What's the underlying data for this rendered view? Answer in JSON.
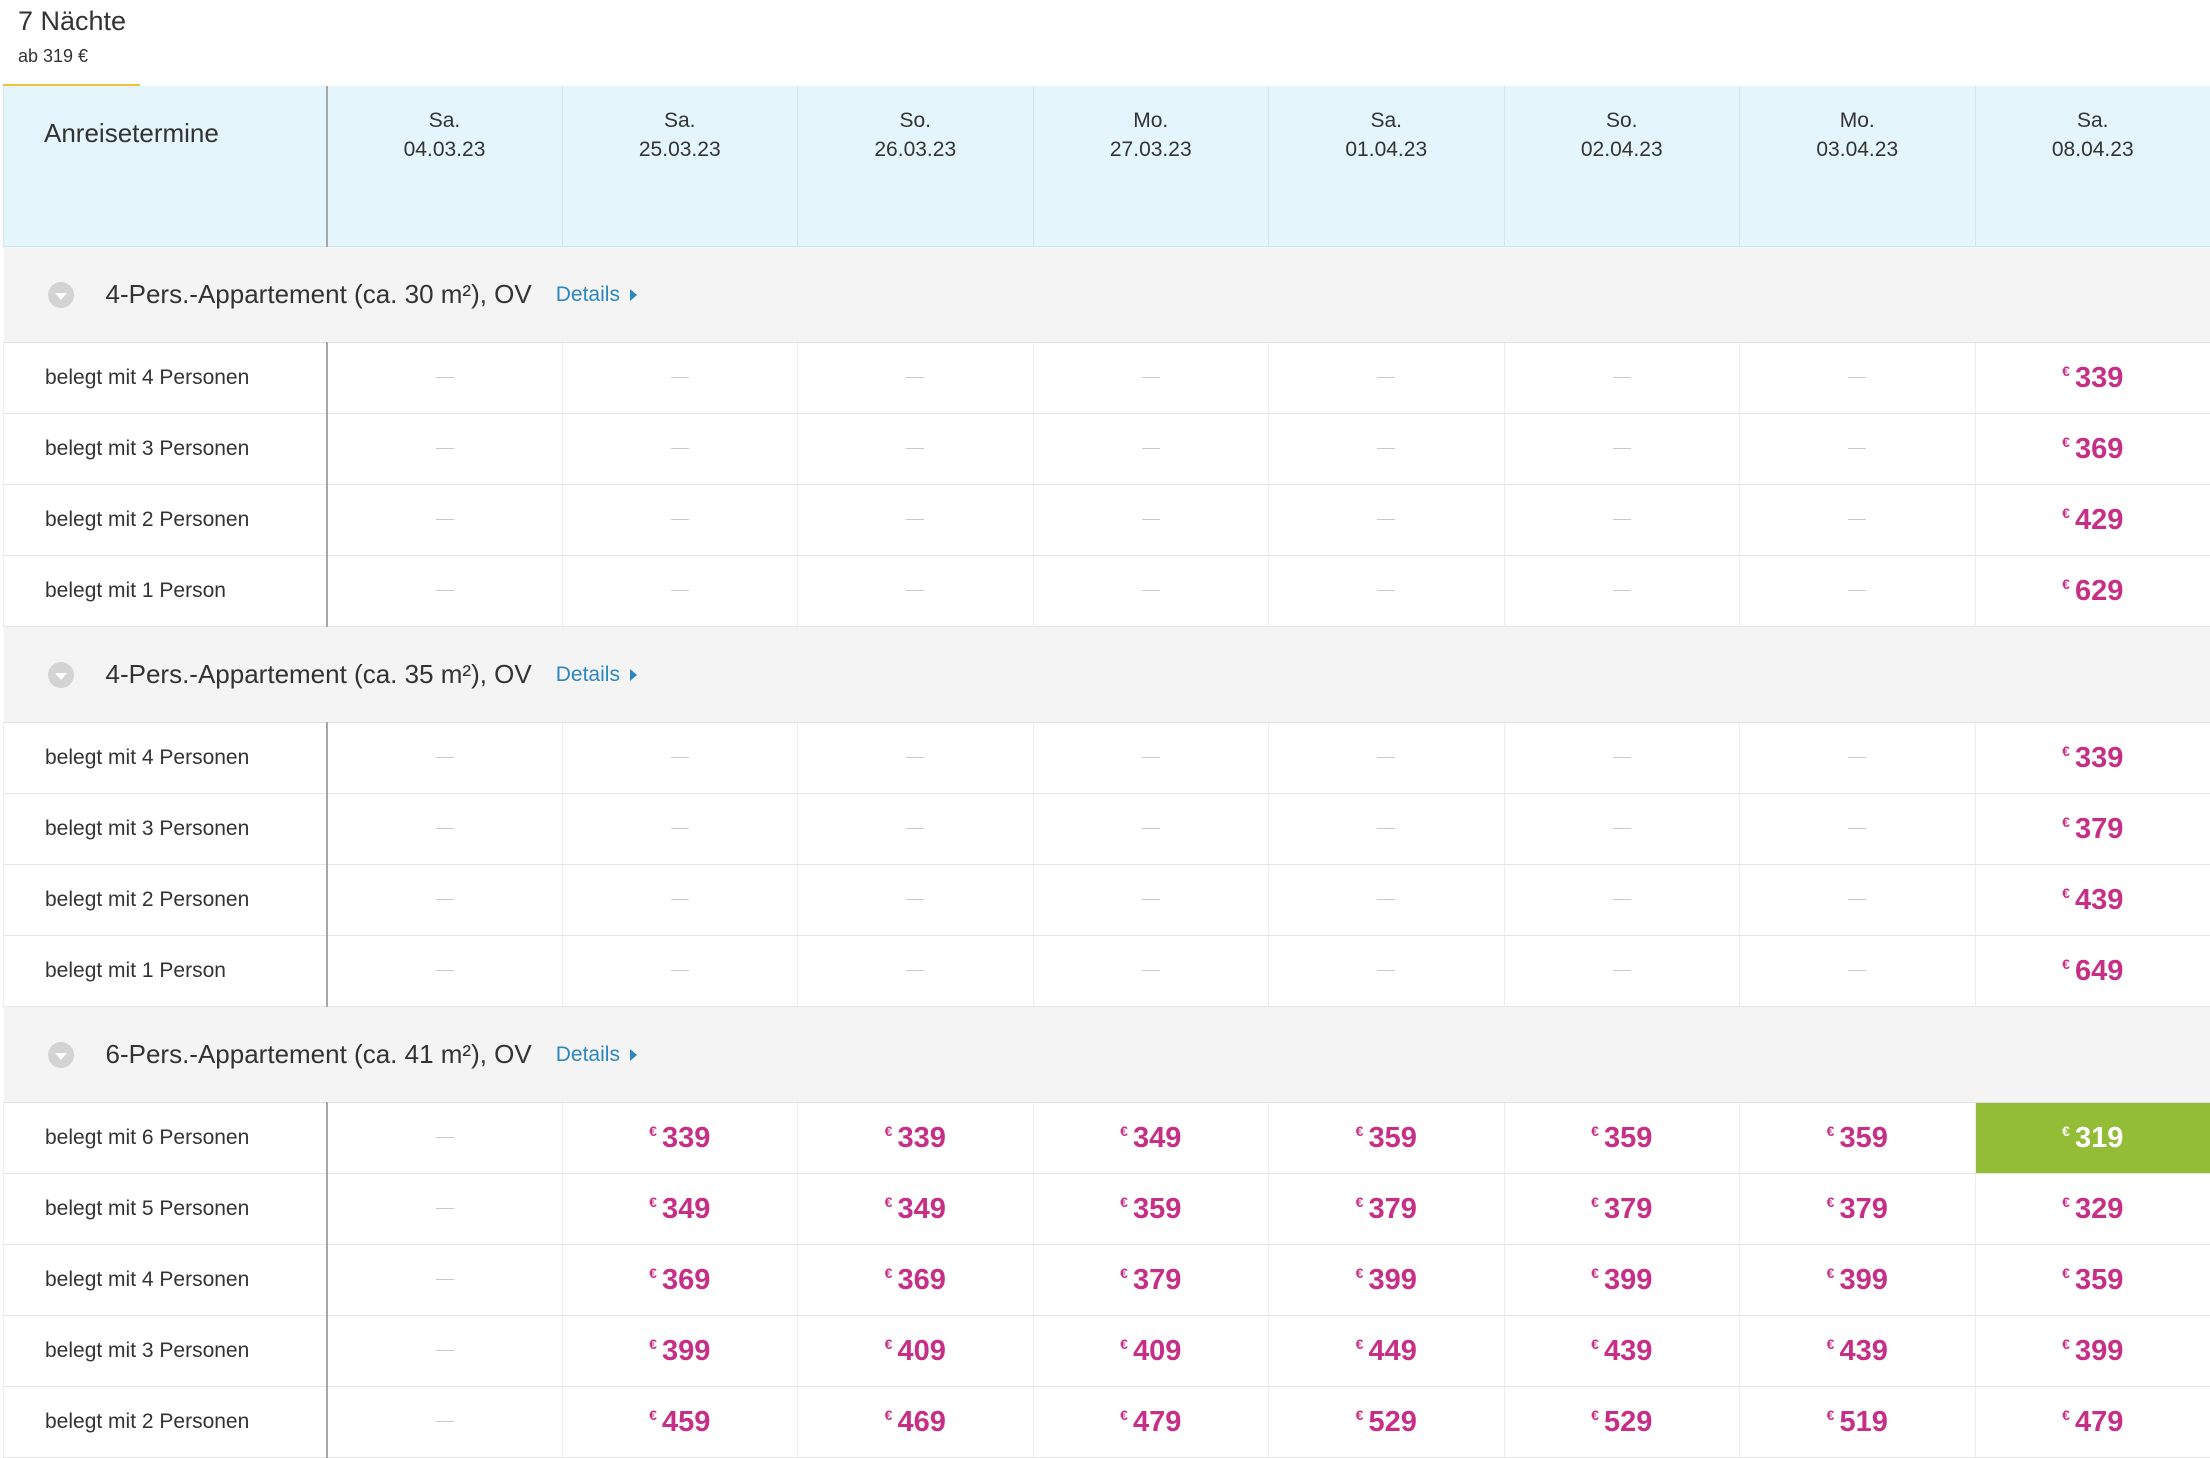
{
  "tab": {
    "title": "7 Nächte",
    "subtitle": "ab 319 €"
  },
  "header": {
    "label": "Anreisetermine",
    "dates": [
      {
        "day": "Sa.",
        "date": "04.03.23"
      },
      {
        "day": "Sa.",
        "date": "25.03.23"
      },
      {
        "day": "So.",
        "date": "26.03.23"
      },
      {
        "day": "Mo.",
        "date": "27.03.23"
      },
      {
        "day": "Sa.",
        "date": "01.04.23"
      },
      {
        "day": "So.",
        "date": "02.04.23"
      },
      {
        "day": "Mo.",
        "date": "03.04.23"
      },
      {
        "day": "Sa.",
        "date": "08.04.23"
      }
    ]
  },
  "currency_symbol": "€",
  "details_label": "Details",
  "colors": {
    "price": "#c72f86",
    "best_bg": "#93bd37",
    "header_bg": "#e5f5fc",
    "link": "#2b87be",
    "tab_underline": "#f0c33c"
  },
  "groups": [
    {
      "title": "4-Pers.-Appartement (ca. 30 m²), OV",
      "rows": [
        {
          "label": "belegt mit 4 Personen",
          "prices": [
            null,
            null,
            null,
            null,
            null,
            null,
            null,
            "339"
          ]
        },
        {
          "label": "belegt mit 3 Personen",
          "prices": [
            null,
            null,
            null,
            null,
            null,
            null,
            null,
            "369"
          ]
        },
        {
          "label": "belegt mit 2 Personen",
          "prices": [
            null,
            null,
            null,
            null,
            null,
            null,
            null,
            "429"
          ]
        },
        {
          "label": "belegt mit 1 Person",
          "prices": [
            null,
            null,
            null,
            null,
            null,
            null,
            null,
            "629"
          ]
        }
      ]
    },
    {
      "title": "4-Pers.-Appartement (ca. 35 m²), OV",
      "rows": [
        {
          "label": "belegt mit 4 Personen",
          "prices": [
            null,
            null,
            null,
            null,
            null,
            null,
            null,
            "339"
          ]
        },
        {
          "label": "belegt mit 3 Personen",
          "prices": [
            null,
            null,
            null,
            null,
            null,
            null,
            null,
            "379"
          ]
        },
        {
          "label": "belegt mit 2 Personen",
          "prices": [
            null,
            null,
            null,
            null,
            null,
            null,
            null,
            "439"
          ]
        },
        {
          "label": "belegt mit 1 Person",
          "prices": [
            null,
            null,
            null,
            null,
            null,
            null,
            null,
            "649"
          ]
        }
      ]
    },
    {
      "title": "6-Pers.-Appartement (ca. 41 m²), OV",
      "rows": [
        {
          "label": "belegt mit 6 Personen",
          "prices": [
            null,
            "339",
            "339",
            "349",
            "359",
            "359",
            "359",
            "319"
          ],
          "best_index": 7
        },
        {
          "label": "belegt mit 5 Personen",
          "prices": [
            null,
            "349",
            "349",
            "359",
            "379",
            "379",
            "379",
            "329"
          ]
        },
        {
          "label": "belegt mit 4 Personen",
          "prices": [
            null,
            "369",
            "369",
            "379",
            "399",
            "399",
            "399",
            "359"
          ]
        },
        {
          "label": "belegt mit 3 Personen",
          "prices": [
            null,
            "399",
            "409",
            "409",
            "449",
            "439",
            "439",
            "399"
          ]
        },
        {
          "label": "belegt mit 2 Personen",
          "prices": [
            null,
            "459",
            "469",
            "479",
            "529",
            "529",
            "519",
            "479"
          ]
        }
      ]
    }
  ]
}
